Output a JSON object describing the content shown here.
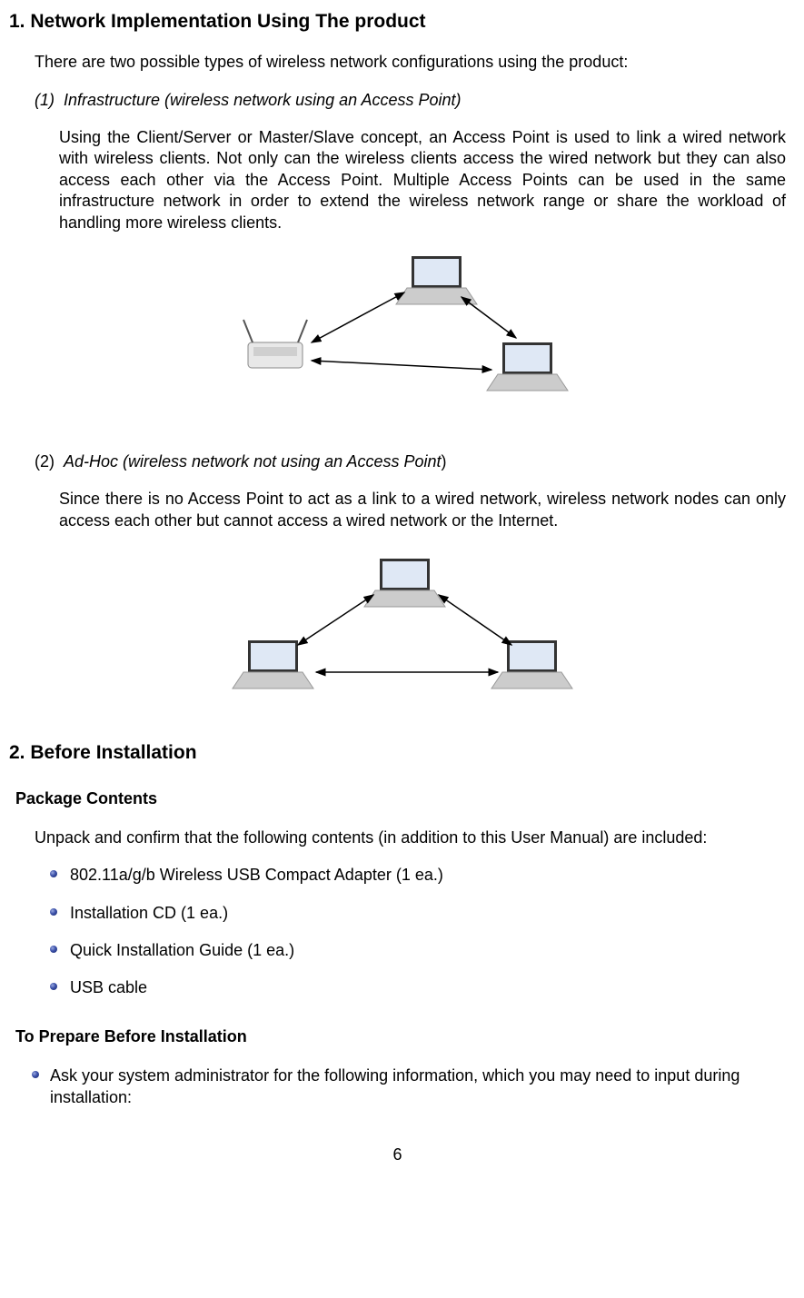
{
  "section1": {
    "heading": "1. Network Implementation Using The product",
    "intro": "There are two possible types of wireless network configurations using the product:",
    "item1_num": "(1)",
    "item1_title": "Infrastructure (wireless network using an Access Point)",
    "item1_body": "Using the Client/Server or Master/Slave concept, an Access Point is used to link a wired network with wireless clients. Not only can the wireless clients access the wired network but they can also access each other via the Access Point. Multiple Access Points can be used in the same infrastructure network in order to extend the wireless network range or share the workload of handling more wireless clients.",
    "item2_num": "(2)",
    "item2_title": "Ad-Hoc (wireless network not using an Access Point",
    "item2_paren": ")",
    "item2_body": "Since there is no Access Point to act as a link to a wired network, wireless network nodes can only access each other but cannot access a wired network or the Internet."
  },
  "section2": {
    "heading": "2. Before Installation",
    "pkg_heading": "Package Contents",
    "pkg_intro": "Unpack and confirm that the following contents (in addition to this User Manual) are included:",
    "pkg_items": [
      "802.11a/g/b Wireless USB Compact Adapter (1 ea.)",
      "Installation CD (1 ea.)",
      "Quick Installation Guide (1 ea.)",
      "USB cable"
    ],
    "prep_heading": "To Prepare Before Installation",
    "prep_items": [
      "Ask your system administrator for the following information, which you may need to input during installation:"
    ]
  },
  "page_number": "6"
}
